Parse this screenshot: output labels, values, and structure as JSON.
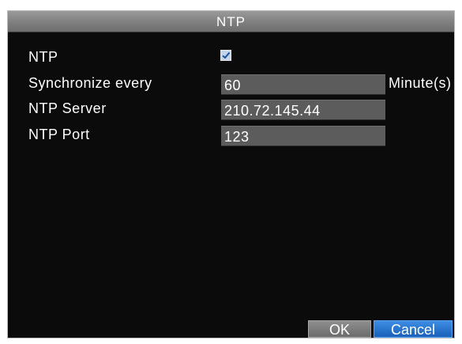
{
  "dialog": {
    "title": "NTP"
  },
  "form": {
    "ntp_enabled_label": "NTP",
    "ntp_enabled": true,
    "sync_label": "Synchronize every",
    "sync_value": "60",
    "sync_unit": "Minute(s)",
    "server_label": "NTP Server",
    "server_value": "210.72.145.44",
    "port_label": "NTP Port",
    "port_value": "123"
  },
  "buttons": {
    "ok_label": "OK",
    "cancel_label": "Cancel"
  },
  "icons": {
    "checkbox": "checkmark-icon"
  },
  "colors": {
    "background": "#0b0b0b",
    "titlebar": "#8a8a8a",
    "field": "#5c5c5c",
    "cancel_accent": "#1f6fd0",
    "text": "#ffffff"
  }
}
